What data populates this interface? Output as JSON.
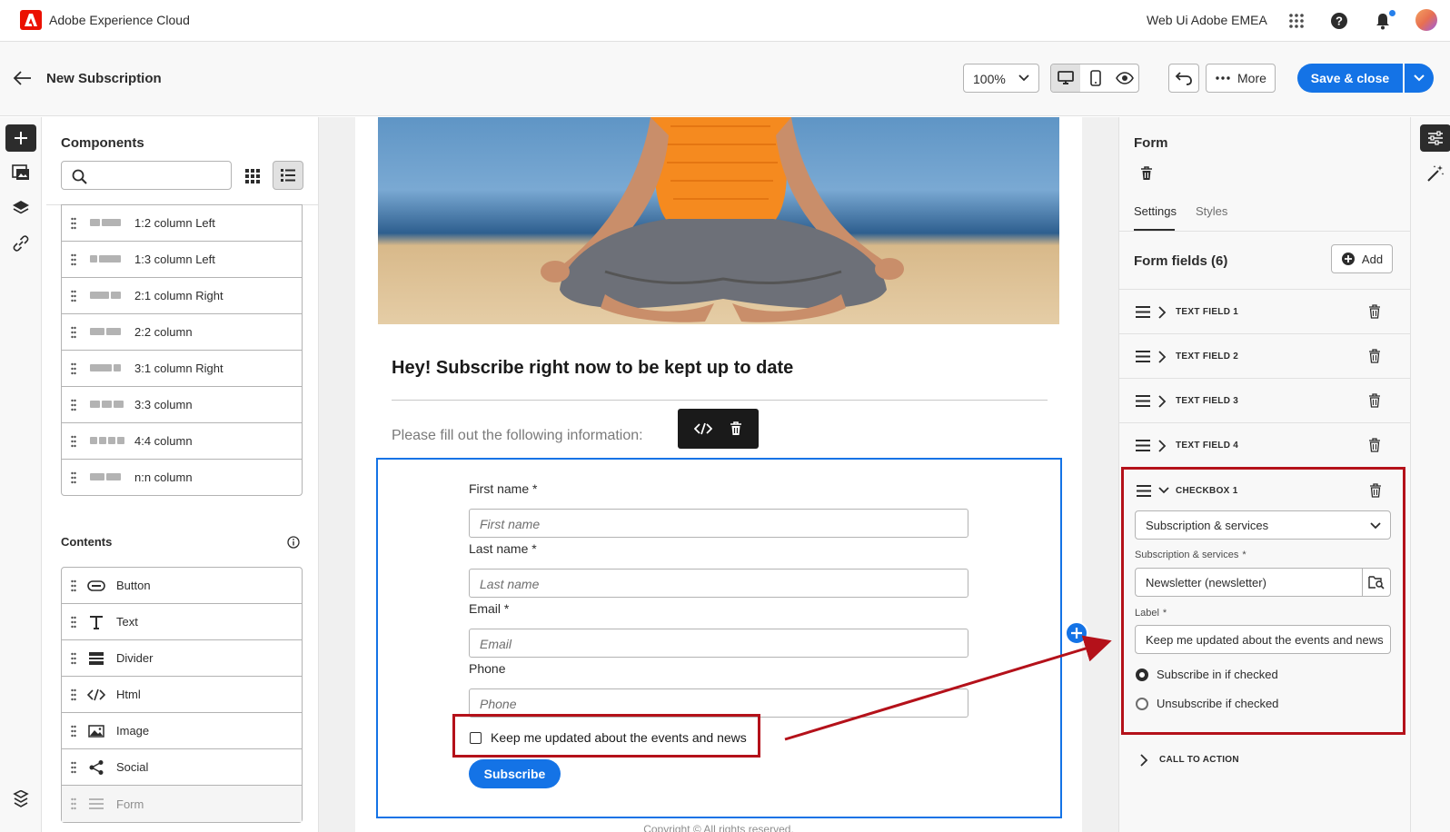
{
  "topbar": {
    "app_title": "Adobe Experience Cloud",
    "org_name": "Web Ui Adobe EMEA",
    "icons": [
      "apps-grid-icon",
      "help-icon",
      "bell-icon"
    ]
  },
  "header": {
    "title": "New Subscription",
    "zoom": "100%",
    "more_label": "More",
    "save_label": "Save & close"
  },
  "components_panel": {
    "title": "Components",
    "search_placeholder": "",
    "structures": [
      {
        "label": "1:2 column Left",
        "cols": [
          1,
          2
        ]
      },
      {
        "label": "1:3 column Left",
        "cols": [
          1,
          3
        ]
      },
      {
        "label": "2:1 column Right",
        "cols": [
          2,
          1
        ]
      },
      {
        "label": "2:2 column",
        "cols": [
          1,
          1
        ]
      },
      {
        "label": "3:1 column Right",
        "cols": [
          3,
          1
        ]
      },
      {
        "label": "3:3 column",
        "cols": [
          1,
          1,
          1
        ]
      },
      {
        "label": "4:4 column",
        "cols": [
          1,
          1,
          1,
          1
        ]
      },
      {
        "label": "n:n column",
        "cols": [
          1,
          1
        ]
      }
    ],
    "contents_title": "Contents",
    "contents": [
      {
        "label": "Button",
        "icon": "button-icon"
      },
      {
        "label": "Text",
        "icon": "text-icon"
      },
      {
        "label": "Divider",
        "icon": "divider-icon"
      },
      {
        "label": "Html",
        "icon": "html-icon"
      },
      {
        "label": "Image",
        "icon": "image-icon"
      },
      {
        "label": "Social",
        "icon": "share-icon"
      },
      {
        "label": "Form",
        "icon": "form-icon"
      }
    ]
  },
  "canvas": {
    "headline": "Hey! Subscribe right now to be kept up to date",
    "intro": "Please fill out the following information:",
    "fields": [
      {
        "label": "First name",
        "required": "*",
        "placeholder": "First name"
      },
      {
        "label": "Last name",
        "required": "*",
        "placeholder": "Last name"
      },
      {
        "label": "Email",
        "required": "*",
        "placeholder": "Email"
      },
      {
        "label": "Phone",
        "required": "",
        "placeholder": "Phone"
      }
    ],
    "checkbox_label": "Keep me updated about the events and news",
    "subscribe_label": "Subscribe",
    "copyright": "Copyright ©  All rights reserved."
  },
  "properties": {
    "title": "Form",
    "tabs": [
      "Settings",
      "Styles"
    ],
    "active_tab": "Settings",
    "form_fields_title": "Form fields (6)",
    "add_label": "Add",
    "fields": [
      "TEXT FIELD 1",
      "TEXT FIELD 2",
      "TEXT FIELD 3",
      "TEXT FIELD 4"
    ],
    "checkbox": {
      "name": "CHECKBOX 1",
      "type_select": "Subscription & services",
      "service_label": "Subscription & services",
      "service_value": "Newsletter (newsletter)",
      "label_label": "Label",
      "label_value": "Keep me updated about the events and news",
      "required_mark": "*",
      "options": [
        "Subscribe in if checked",
        "Unsubscribe if checked"
      ],
      "selected_option": 0
    },
    "cta": "CALL TO ACTION"
  },
  "colors": {
    "accent": "#1473e6",
    "highlight": "#b4111a",
    "adobe_red": "#eb1000"
  }
}
